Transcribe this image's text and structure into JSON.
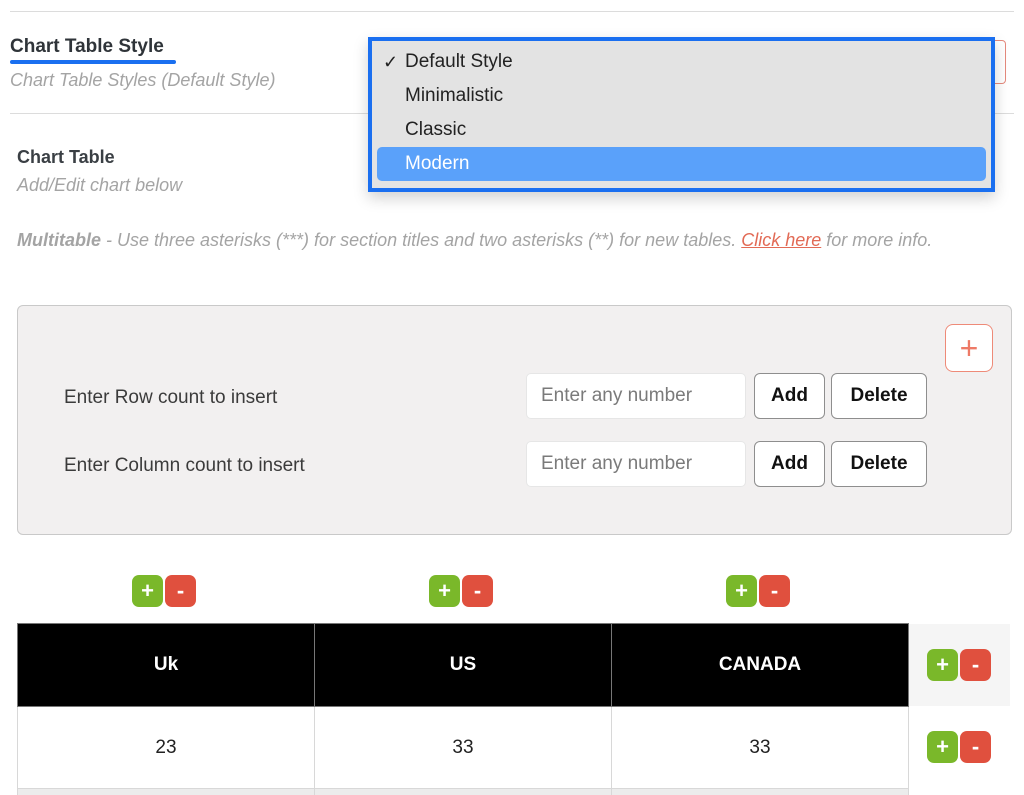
{
  "style_section": {
    "title": "Chart Table Style",
    "subtitle": "Chart Table Styles (Default Style)",
    "dropdown": {
      "options": [
        {
          "label": "Default Style",
          "checked": true,
          "highlighted": false
        },
        {
          "label": "Minimalistic",
          "checked": false,
          "highlighted": false
        },
        {
          "label": "Classic",
          "checked": false,
          "highlighted": false
        },
        {
          "label": "Modern",
          "checked": false,
          "highlighted": true
        }
      ],
      "check_glyph": "✓"
    }
  },
  "chart_table_section": {
    "title": "Chart Table",
    "subtitle": "Add/Edit chart below",
    "multitable": {
      "label": "Multitable",
      "text": " - Use three asterisks (***) for section titles and two asterisks (**) for new tables. ",
      "link": "Click here",
      "after": " for more info."
    }
  },
  "panel": {
    "add_icon": "+",
    "rows": [
      {
        "label": "Enter Row count to insert",
        "placeholder": "Enter any number",
        "add": "Add",
        "delete": "Delete"
      },
      {
        "label": "Enter Column count to insert",
        "placeholder": "Enter any number",
        "add": "Add",
        "delete": "Delete"
      }
    ]
  },
  "controls": {
    "plus": "+",
    "minus": "-"
  },
  "table": {
    "headers": [
      "Uk",
      "US",
      "CANADA"
    ],
    "rows": [
      [
        "23",
        "33",
        "33"
      ]
    ]
  },
  "colors": {
    "accent": "#1a6ff0",
    "highlight": "#5aa1fa",
    "plus": "#7ab82a",
    "minus": "#e0503e",
    "link": "#e26a55"
  }
}
